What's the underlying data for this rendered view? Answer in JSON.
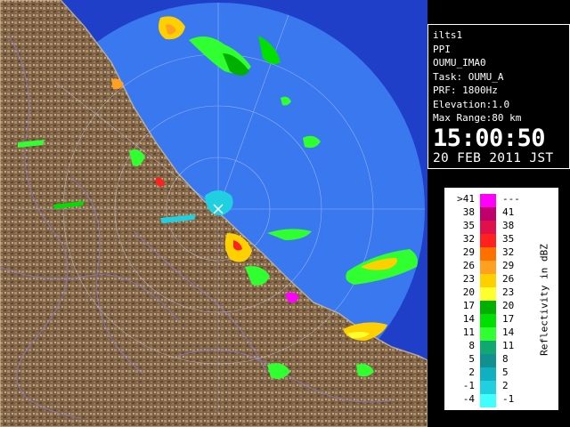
{
  "colors": {
    "scan_disc": "#3a78f0",
    "outside": "#1f3fc8",
    "land": "#8b6d4c",
    "no_echo_marker": "#ffffff"
  },
  "info": {
    "lines": [
      "ilts1",
      "PPI",
      "OUMU_IMA0",
      "Task: OUMU_A",
      "PRF: 1800Hz",
      "Elevation:1.0",
      "Max Range:80 km"
    ],
    "time": "15:00:50",
    "date": "20 FEB 2011 JST"
  },
  "legend": {
    "unit": "Reflectivity in dBZ",
    "rows": [
      {
        "low": ">41",
        "high": "---",
        "color": "#ff00ff"
      },
      {
        "low": "38",
        "high": "41",
        "color": "#c0006a"
      },
      {
        "low": "35",
        "high": "38",
        "color": "#e0104a"
      },
      {
        "low": "32",
        "high": "35",
        "color": "#ff2020"
      },
      {
        "low": "29",
        "high": "32",
        "color": "#ff7000"
      },
      {
        "low": "26",
        "high": "29",
        "color": "#ffa020"
      },
      {
        "low": "23",
        "high": "26",
        "color": "#ffd000"
      },
      {
        "low": "20",
        "high": "23",
        "color": "#ffff30"
      },
      {
        "low": "17",
        "high": "20",
        "color": "#00b000"
      },
      {
        "low": "14",
        "high": "17",
        "color": "#00e000"
      },
      {
        "low": "11",
        "high": "14",
        "color": "#30ff30"
      },
      {
        "low": "8",
        "high": "11",
        "color": "#10a870"
      },
      {
        "low": "5",
        "high": "8",
        "color": "#109090"
      },
      {
        "low": "2",
        "high": "5",
        "color": "#10b0c0"
      },
      {
        "low": "-1",
        "high": "2",
        "color": "#20d0e0"
      },
      {
        "low": "-4",
        "high": "-1",
        "color": "#40ffff"
      }
    ]
  }
}
